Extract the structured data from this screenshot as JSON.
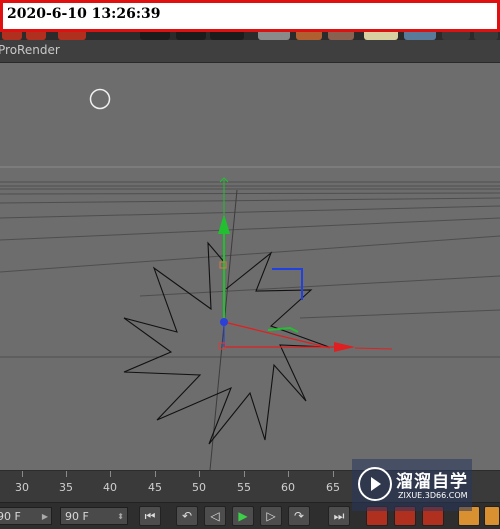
{
  "timestamp": "2020-6-10 13:26:39",
  "menubar": {
    "title": "ProRender"
  },
  "timeline": {
    "ticks": [
      "30",
      "35",
      "40",
      "45",
      "50",
      "55",
      "60",
      "65"
    ]
  },
  "transport": {
    "frame_start": "90 F",
    "frame_end": "90 F",
    "buttons": [
      "go-to-start",
      "prev-key",
      "play-backward",
      "play-forward",
      "next-key",
      "loop",
      "go-to-end"
    ]
  },
  "watermark": {
    "brand": "溜溜自学",
    "url": "ZIXUE.3D66.COM"
  },
  "colors": {
    "stamp_border": "#e01010",
    "axis_y": "#22c030",
    "axis_x": "#e02020",
    "axis_z": "#2040e0"
  }
}
